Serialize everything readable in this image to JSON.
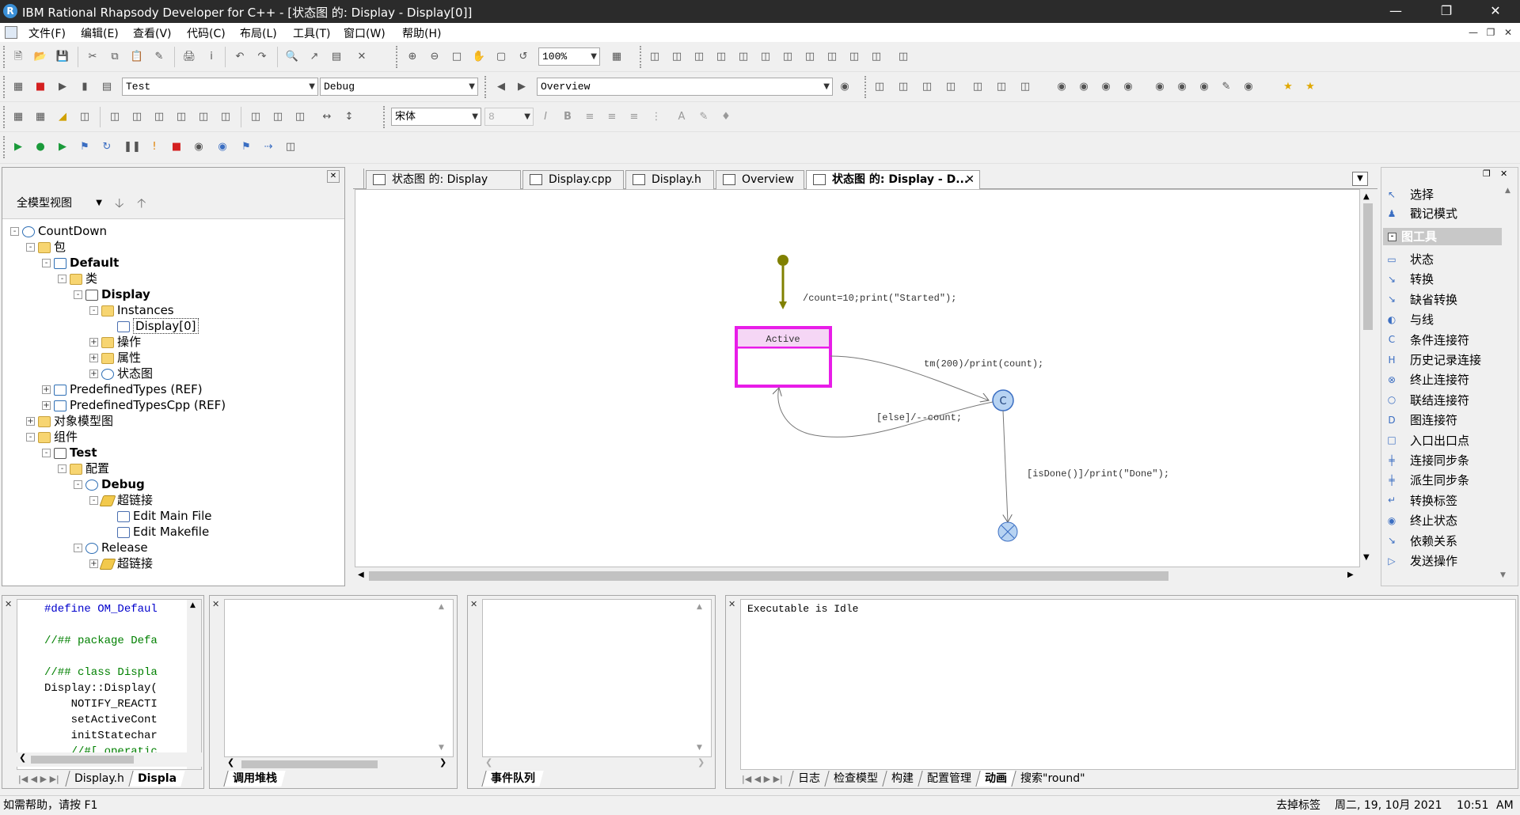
{
  "window": {
    "title": "IBM Rational Rhapsody Developer for C++ - [状态图 的:  Display - Display[0]]",
    "app_icon": "R"
  },
  "menu": [
    "文件(F)",
    "编辑(E)",
    "查看(V)",
    "代码(C)",
    "布局(L)",
    "工具(T)",
    "窗口(W)",
    "帮助(H)"
  ],
  "toolbar": {
    "zoom": "100%",
    "config": "Test",
    "build": "Debug",
    "diagram_select": "Overview",
    "font_name": "宋体",
    "font_size": "8"
  },
  "browser": {
    "view_label": "全模型视图",
    "tree": [
      {
        "label": "CountDown",
        "level": 0,
        "icon": "project",
        "bold": false,
        "exp": "-"
      },
      {
        "label": "包",
        "level": 1,
        "icon": "folder",
        "exp": "-"
      },
      {
        "label": "Default",
        "level": 2,
        "icon": "package",
        "bold": true,
        "exp": "-"
      },
      {
        "label": "类",
        "level": 3,
        "icon": "folder",
        "exp": "-"
      },
      {
        "label": "Display",
        "level": 4,
        "icon": "class",
        "bold": true,
        "exp": "-"
      },
      {
        "label": "Instances",
        "level": 5,
        "icon": "folder",
        "exp": "-"
      },
      {
        "label": "Display[0]",
        "level": 6,
        "icon": "doc",
        "exp": "",
        "selected": true
      },
      {
        "label": "操作",
        "level": 5,
        "icon": "folder",
        "exp": "+"
      },
      {
        "label": "属性",
        "level": 5,
        "icon": "folder",
        "exp": "+"
      },
      {
        "label": "状态图",
        "level": 5,
        "icon": "gear",
        "exp": "+"
      },
      {
        "label": "PredefinedTypes (REF)",
        "level": 2,
        "icon": "package",
        "exp": "+"
      },
      {
        "label": "PredefinedTypesCpp (REF)",
        "level": 2,
        "icon": "package",
        "exp": "+"
      },
      {
        "label": "对象模型图",
        "level": 1,
        "icon": "folder",
        "exp": "+"
      },
      {
        "label": "组件",
        "level": 1,
        "icon": "folder",
        "exp": "-"
      },
      {
        "label": "Test",
        "level": 2,
        "icon": "class",
        "bold": true,
        "exp": "-"
      },
      {
        "label": "配置",
        "level": 3,
        "icon": "folder",
        "exp": "-"
      },
      {
        "label": "Debug",
        "level": 4,
        "icon": "gear",
        "bold": true,
        "exp": "-"
      },
      {
        "label": "超链接",
        "level": 5,
        "icon": "link",
        "exp": "-"
      },
      {
        "label": "Edit Main File",
        "level": 6,
        "icon": "doc",
        "exp": ""
      },
      {
        "label": "Edit Makefile",
        "level": 6,
        "icon": "doc",
        "exp": ""
      },
      {
        "label": "Release",
        "level": 4,
        "icon": "gear",
        "exp": "-"
      },
      {
        "label": "超链接",
        "level": 5,
        "icon": "link",
        "exp": "+"
      }
    ]
  },
  "editor_tabs": [
    {
      "label": "状态图 的:  Display",
      "active": false
    },
    {
      "label": "Display.cpp",
      "active": false
    },
    {
      "label": "Display.h",
      "active": false
    },
    {
      "label": "Overview",
      "active": false
    },
    {
      "label": "状态图 的:  Display - D...",
      "active": true
    }
  ],
  "diagram": {
    "state_name": "Active",
    "initial_action": "/count=10;print(\"Started\");",
    "timeout_label": "tm(200)/print(count);",
    "else_label": "[else]/--count;",
    "done_label": "[isDone()]/print(\"Done\");",
    "condition_glyph": "C",
    "accent_state": "#e81ce8",
    "accent_initial": "#808000"
  },
  "tools": {
    "items_top": [
      {
        "label": "选择",
        "icon": "pointer-icon"
      },
      {
        "label": "戳记模式",
        "icon": "stamp-icon"
      }
    ],
    "section": "图工具",
    "items": [
      {
        "label": "状态",
        "icon": "state-icon"
      },
      {
        "label": "转换",
        "icon": "transition-icon"
      },
      {
        "label": "缺省转换",
        "icon": "default-transition-icon"
      },
      {
        "label": "与线",
        "icon": "and-line-icon"
      },
      {
        "label": "条件连接符",
        "icon": "condition-connector-icon"
      },
      {
        "label": "历史记录连接",
        "icon": "history-connector-icon"
      },
      {
        "label": "终止连接符",
        "icon": "termination-connector-icon"
      },
      {
        "label": "联结连接符",
        "icon": "junction-connector-icon"
      },
      {
        "label": "图连接符",
        "icon": "diagram-connector-icon"
      },
      {
        "label": "入口出口点",
        "icon": "entry-exit-point-icon"
      },
      {
        "label": "连接同步条",
        "icon": "join-sync-bar-icon"
      },
      {
        "label": "派生同步条",
        "icon": "fork-sync-bar-icon"
      },
      {
        "label": "转换标签",
        "icon": "transition-label-icon"
      },
      {
        "label": "终止状态",
        "icon": "termination-state-icon"
      },
      {
        "label": "依赖关系",
        "icon": "dependency-icon"
      },
      {
        "label": "发送操作",
        "icon": "send-action-icon"
      }
    ]
  },
  "code_pane": {
    "lines": [
      {
        "text": "#define OM_Defaul",
        "color": "#0000cc"
      },
      {
        "text": "",
        "color": "#000"
      },
      {
        "text": "//## package Defa",
        "color": "#008000"
      },
      {
        "text": "",
        "color": "#000"
      },
      {
        "text": "//## class Displa",
        "color": "#008000"
      },
      {
        "text": "Display::Display(",
        "color": "#000"
      },
      {
        "text": "    NOTIFY_REACTI",
        "color": "#000"
      },
      {
        "text": "    setActiveCont",
        "color": "#000"
      },
      {
        "text": "    initStatechar",
        "color": "#000"
      },
      {
        "text": "    //#[ operatic",
        "color": "#008000"
      }
    ],
    "tabs": [
      "Display.h",
      "Displa"
    ]
  },
  "callstack_pane": {
    "tab": "调用堆栈"
  },
  "eventqueue_pane": {
    "tab": "事件队列"
  },
  "output_pane": {
    "text": "Executable is Idle",
    "tabs": [
      "日志",
      "检查模型",
      "构建",
      "配置管理",
      "动画",
      "搜索\"round\""
    ],
    "selected": "动画"
  },
  "status": {
    "help": "如需帮助，请按 F1",
    "tag": "去掉标签",
    "date": "周二, 19, 10月 2021",
    "time": "10:51",
    "ampm": "AM"
  }
}
